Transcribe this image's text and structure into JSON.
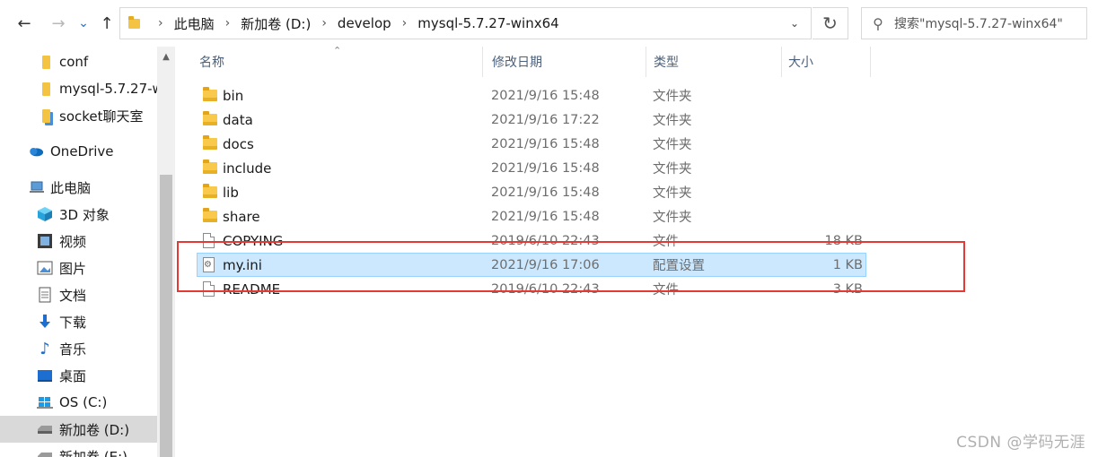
{
  "toolbar": {
    "back_icon": "←",
    "forward_icon": "→",
    "history_icon": "⌄",
    "up_icon": "↑",
    "refresh_icon": "↻",
    "dropdown_icon": "⌄",
    "search_icon": "⚲"
  },
  "breadcrumb": [
    "此电脑",
    "新加卷 (D:)",
    "develop",
    "mysql-5.7.27-winx64"
  ],
  "breadcrumb_separator": "›",
  "search": {
    "placeholder": "搜索\"mysql-5.7.27-winx64\""
  },
  "sidebar": {
    "items": [
      {
        "label": "conf",
        "icon": "folder-icon"
      },
      {
        "label": "mysql-5.7.27-w",
        "icon": "folder-icon"
      },
      {
        "label": "socket聊天室",
        "icon": "folder-icon"
      },
      {
        "label": "OneDrive",
        "icon": "cloud-icon"
      },
      {
        "label": "此电脑",
        "icon": "computer-icon"
      },
      {
        "label": "3D 对象",
        "icon": "cube-icon"
      },
      {
        "label": "视频",
        "icon": "video-icon"
      },
      {
        "label": "图片",
        "icon": "picture-icon"
      },
      {
        "label": "文档",
        "icon": "document-icon"
      },
      {
        "label": "下载",
        "icon": "download-icon"
      },
      {
        "label": "音乐",
        "icon": "music-icon"
      },
      {
        "label": "桌面",
        "icon": "desktop-icon"
      },
      {
        "label": "OS (C:)",
        "icon": "windows-drive-icon"
      },
      {
        "label": "新加卷 (D:)",
        "icon": "drive-icon"
      },
      {
        "label": "新加卷 (E:)",
        "icon": "drive-icon"
      }
    ],
    "selected": "新加卷 (D:)"
  },
  "columns": {
    "name": "名称",
    "modified": "修改日期",
    "type": "类型",
    "size": "大小"
  },
  "files": [
    {
      "name": "bin",
      "modified": "2021/9/16 15:48",
      "type": "文件夹",
      "size": "",
      "kind": "folder"
    },
    {
      "name": "data",
      "modified": "2021/9/16 17:22",
      "type": "文件夹",
      "size": "",
      "kind": "folder"
    },
    {
      "name": "docs",
      "modified": "2021/9/16 15:48",
      "type": "文件夹",
      "size": "",
      "kind": "folder"
    },
    {
      "name": "include",
      "modified": "2021/9/16 15:48",
      "type": "文件夹",
      "size": "",
      "kind": "folder"
    },
    {
      "name": "lib",
      "modified": "2021/9/16 15:48",
      "type": "文件夹",
      "size": "",
      "kind": "folder"
    },
    {
      "name": "share",
      "modified": "2021/9/16 15:48",
      "type": "文件夹",
      "size": "",
      "kind": "folder"
    },
    {
      "name": "COPYING",
      "modified": "2019/6/10 22:43",
      "type": "文件",
      "size": "18 KB",
      "kind": "file"
    },
    {
      "name": "my.ini",
      "modified": "2021/9/16 17:06",
      "type": "配置设置",
      "size": "1 KB",
      "kind": "ini"
    },
    {
      "name": "README",
      "modified": "2019/6/10 22:43",
      "type": "文件",
      "size": "3 KB",
      "kind": "file"
    }
  ],
  "selected_file": "my.ini",
  "highlight_color": "#e53935",
  "watermark": "CSDN @学码无涯"
}
